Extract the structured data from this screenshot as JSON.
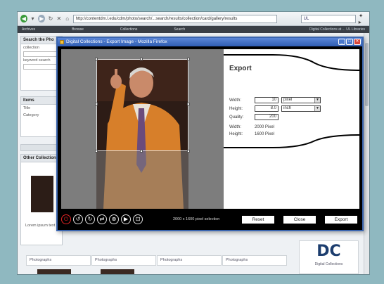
{
  "browser": {
    "url": "http://contentdm.l.edu/cdm/photo/search/...search/results/collection/card/gallery/results",
    "search_value": "UL",
    "site_nav": [
      "Archives",
      "Browse",
      "Collections",
      "Search"
    ],
    "site_nav_right": "Digital Collections at ... UL Libraries"
  },
  "page": {
    "search_panel_title": "Search the Pho",
    "search_labels": [
      "collection",
      "keyword search"
    ],
    "items_panel_title": "Items",
    "items_panel_lines": [
      "Title",
      "Category"
    ],
    "other_panel_title": "Other Collections",
    "caption_text": "Lorem ipsum text",
    "thumb_captions": [
      "Photographs",
      "Photographs",
      "Photographs",
      "Photographs"
    ],
    "logo_mark": "DC",
    "logo_text": "Digital Collections"
  },
  "dialog": {
    "title": "Digital Collections - Export Image - Mozilla Firefox",
    "export": {
      "heading": "Export",
      "width_label": "Width:",
      "width_value": "10",
      "height_label": "Height:",
      "height_value": "8.0",
      "quality_label": "Quality:",
      "quality_value": "200",
      "unit_top": "pixel",
      "unit_bottom": "inch",
      "width_px_label": "Width:",
      "width_px_value": "2000 Pixel",
      "height_px_label": "Height:",
      "height_px_value": "1600 Pixel"
    },
    "controls": {
      "status": "2000 x 1600 pixel selection",
      "reset_label": "Reset",
      "close_label": "Close",
      "export_label": "Export"
    }
  }
}
